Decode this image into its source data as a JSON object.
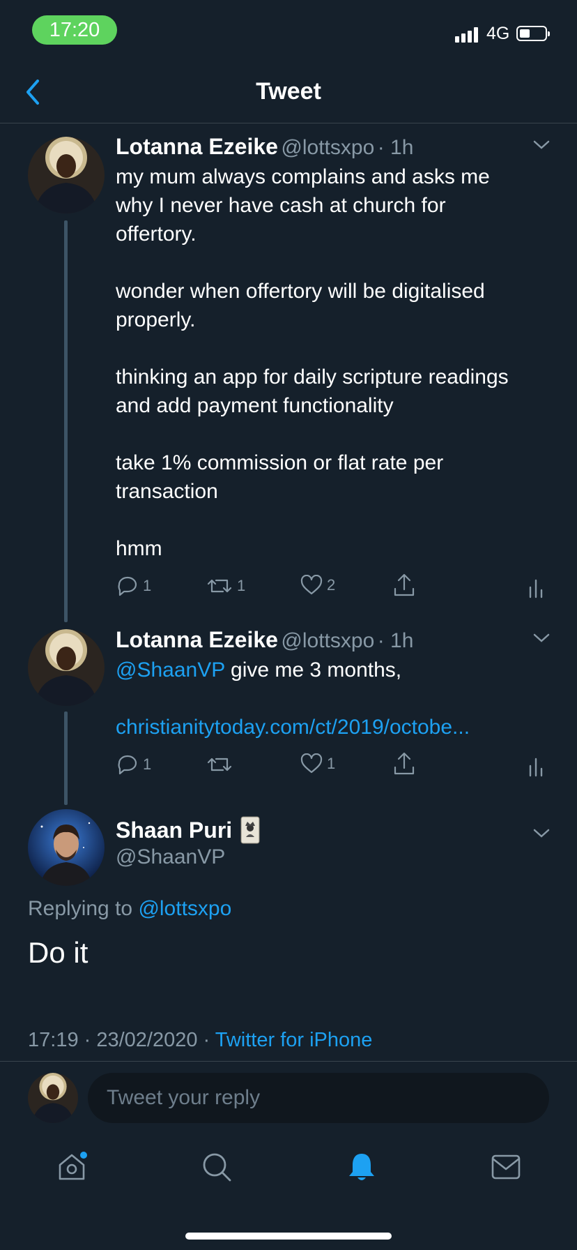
{
  "status_bar": {
    "time": "17:20",
    "network": "4G",
    "accent": "#5ed35e"
  },
  "header": {
    "title": "Tweet"
  },
  "colors": {
    "background": "#15202b",
    "link": "#1da1f2",
    "muted": "#8899a6"
  },
  "tweets": [
    {
      "name": "Lotanna Ezeike",
      "handle": "@lottsxpo",
      "age": "· 1h",
      "text": "my mum always complains and asks me\nwhy I never have cash at church for\noffertory.\n\nwonder when offertory will be digitalised\nproperly.\n\nthinking an app for daily scripture readings\nand add payment functionality\n\ntake 1% commission or flat rate per\ntransaction\n\nhmm",
      "replies": "1",
      "retweets": "1",
      "likes": "2"
    },
    {
      "name": "Lotanna Ezeike",
      "handle": "@lottsxpo",
      "age": "· 1h",
      "mention": "@ShaanVP",
      "text": " give me 3 months,",
      "link": "christianitytoday.com/ct/2019/octobe...",
      "replies": "1",
      "retweets": "",
      "likes": "1"
    }
  ],
  "main_tweet": {
    "name": "Shaan Puri",
    "handle": "@ShaanVP",
    "replying_prefix": "Replying to",
    "replying_to": "@lottsxpo",
    "text": "Do it",
    "timestamp": "17:19 · 23/02/2020 ·",
    "source": "Twitter for iPhone"
  },
  "composer": {
    "placeholder": "Tweet your reply"
  },
  "tabbar": {
    "items": [
      "home-icon",
      "search-icon",
      "notifications-icon",
      "messages-icon"
    ],
    "active": "notifications-icon"
  }
}
